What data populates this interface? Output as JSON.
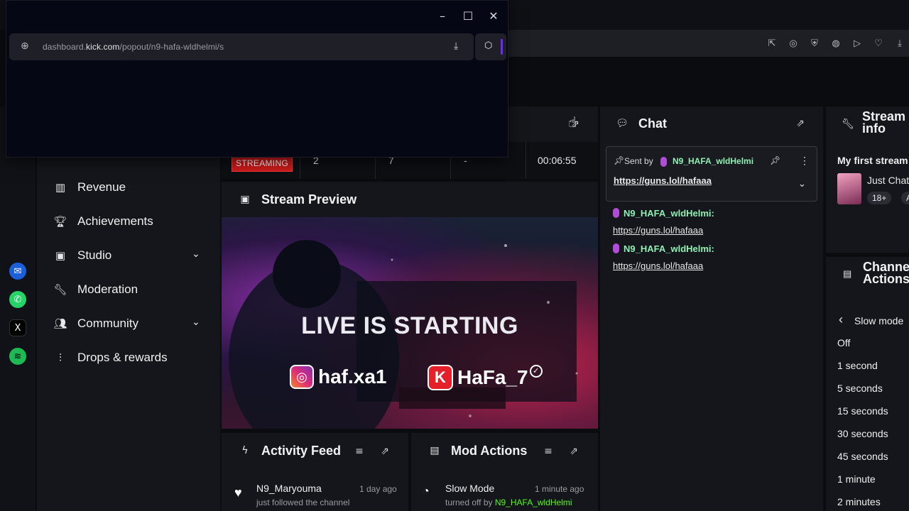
{
  "popup": {
    "url_prefix": "dashboard.",
    "url_domain": "kick.com",
    "url_path": "/popout/n9-hafa-wldhelmi/s"
  },
  "nav": [
    {
      "label": "Revenue",
      "icon": "revenue-icon"
    },
    {
      "label": "Achievements",
      "icon": "trophy-icon"
    },
    {
      "label": "Studio",
      "icon": "studio-icon",
      "expandable": true
    },
    {
      "label": "Moderation",
      "icon": "wrench-icon"
    },
    {
      "label": "Community",
      "icon": "community-icon",
      "expandable": true
    },
    {
      "label": "Drops & rewards",
      "icon": "drops-icon"
    }
  ],
  "stats": {
    "status": "STREAMING",
    "viewers": "2",
    "followers": "7",
    "subs": "-",
    "uptime": "00:06:55"
  },
  "preview": {
    "title": "Stream Preview",
    "overlay_heading": "LIVE IS STARTING",
    "instagram_handle": "haf.xa1",
    "kick_handle": "HaFa_7"
  },
  "chat": {
    "title": "Chat",
    "pinned_sent_by": "Sent by",
    "pinned_user": "N9_HAFA_wldHelmi",
    "pinned_link": "https://guns.lol/hafaaa",
    "messages": [
      {
        "user": "N9_HAFA_wldHelmi:",
        "text": "https://guns.lol/hafaaa"
      },
      {
        "user": "N9_HAFA_wldHelmi:",
        "text": "https://guns.lol/hafaaa"
      }
    ]
  },
  "activity": {
    "title": "Activity Feed",
    "items": [
      {
        "user": "N9_Maryouma",
        "time": "1 day ago",
        "desc": "just followed the channel"
      }
    ]
  },
  "mod_actions": {
    "title": "Mod Actions",
    "items": [
      {
        "action": "Slow Mode",
        "time": "1 minute ago",
        "desc_prefix": "turned off by",
        "user": "N9_HAFA_wldHelmi"
      }
    ]
  },
  "stream_info": {
    "title_line1": "Stream",
    "title_line2": "info",
    "stream_title": "My first stream",
    "category": "Just Chatting",
    "tag": "18+",
    "tag2": "A"
  },
  "channel_actions": {
    "title_line1": "Channel",
    "title_line2": "Actions",
    "back_label": "Slow mode",
    "options": [
      "Off",
      "1 second",
      "5 seconds",
      "15 seconds",
      "30 seconds",
      "45 seconds",
      "1 minute",
      "2 minutes"
    ]
  },
  "colors": {
    "accent_green": "#53fc18",
    "username_green": "#8ef0b3",
    "streaming_red": "#d01b1b",
    "mic_purple": "#b14cd8"
  }
}
